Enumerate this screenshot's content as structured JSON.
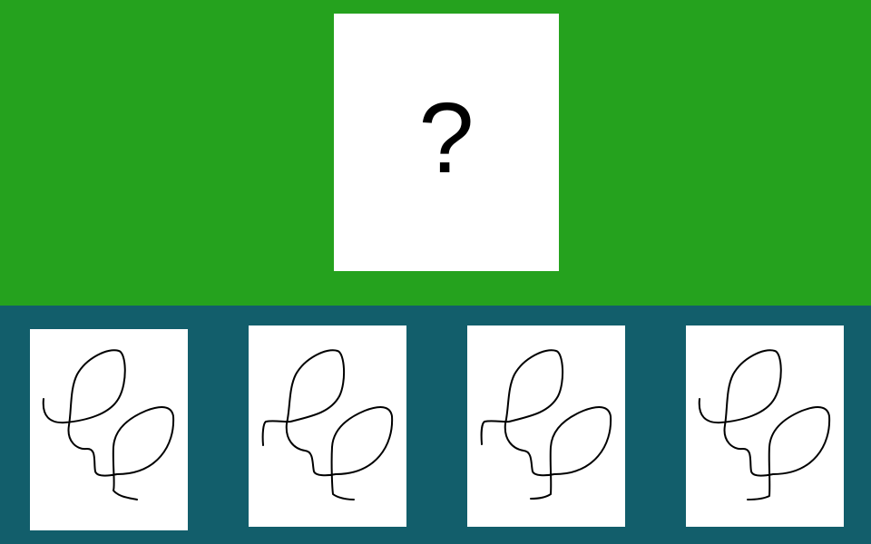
{
  "target": {
    "symbol": "?"
  },
  "choices": [
    {
      "id": "choice-1",
      "variant": "straight-start-long-hook-end"
    },
    {
      "id": "choice-2",
      "variant": "step-start-straight-end"
    },
    {
      "id": "choice-3",
      "variant": "step-start-short-hook-end"
    },
    {
      "id": "choice-4",
      "variant": "straight-start-short-hook-end"
    }
  ],
  "colors": {
    "top_background": "#25a21e",
    "bottom_background": "#125e6b",
    "card": "#ffffff",
    "stroke": "#000000"
  }
}
